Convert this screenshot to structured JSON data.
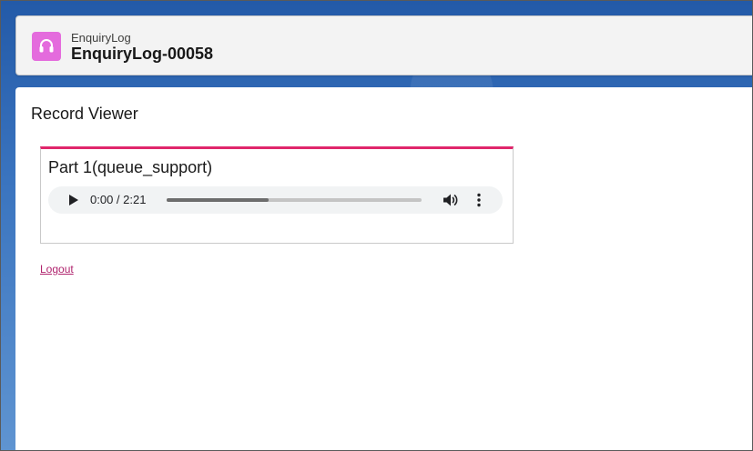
{
  "header": {
    "object_type": "EnquiryLog",
    "record_name": "EnquiryLog-00058",
    "icon": "headset-icon",
    "icon_color": "#e46bdd"
  },
  "main": {
    "title": "Record Viewer",
    "parts": [
      {
        "title": "Part 1(queue_support)",
        "audio": {
          "time_display": "0:00 / 2:21",
          "progress_fraction": 0.4,
          "play_icon": "play-icon",
          "volume_icon": "volume-icon",
          "more_icon": "more-options-icon"
        }
      }
    ],
    "logout_label": "Logout",
    "accent_color": "#e0266b"
  }
}
